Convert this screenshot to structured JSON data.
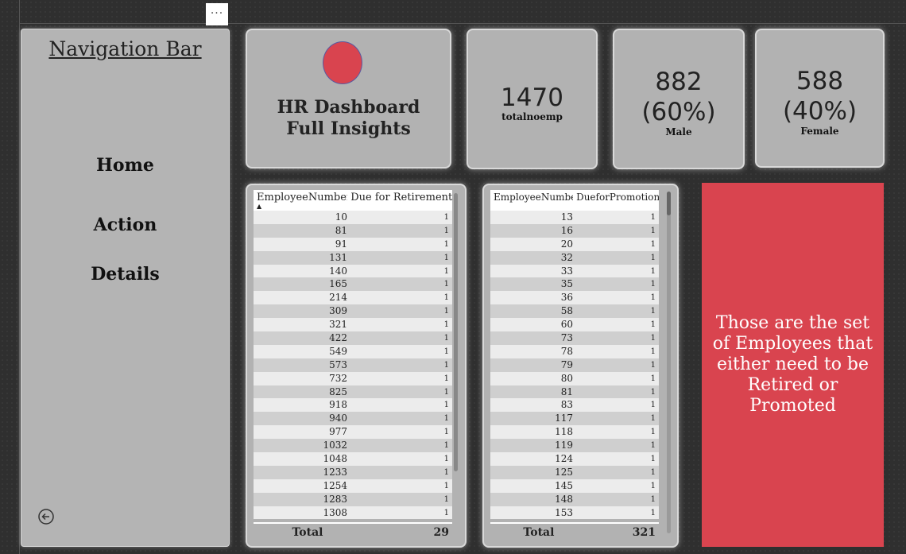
{
  "toolbar": {
    "more_label": "···"
  },
  "nav": {
    "title": "Navigation Bar",
    "items": [
      {
        "label": "Home"
      },
      {
        "label": "Action"
      },
      {
        "label": "Details"
      }
    ]
  },
  "header": {
    "title_line1": "HR Dashboard",
    "title_line2": "Full Insights"
  },
  "kpis": [
    {
      "value": "1470",
      "label": "totalnoemp"
    },
    {
      "value_line1": "882",
      "value_line2": "(60%)",
      "label": "Male"
    },
    {
      "value_line1": "588",
      "value_line2": "(40%)",
      "label": "Female"
    }
  ],
  "retirement_table": {
    "columns": [
      "EmployeeNumber",
      "Due for Retirement"
    ],
    "rows": [
      [
        "10",
        "1"
      ],
      [
        "81",
        "1"
      ],
      [
        "91",
        "1"
      ],
      [
        "131",
        "1"
      ],
      [
        "140",
        "1"
      ],
      [
        "165",
        "1"
      ],
      [
        "214",
        "1"
      ],
      [
        "309",
        "1"
      ],
      [
        "321",
        "1"
      ],
      [
        "422",
        "1"
      ],
      [
        "549",
        "1"
      ],
      [
        "573",
        "1"
      ],
      [
        "732",
        "1"
      ],
      [
        "825",
        "1"
      ],
      [
        "918",
        "1"
      ],
      [
        "940",
        "1"
      ],
      [
        "977",
        "1"
      ],
      [
        "1032",
        "1"
      ],
      [
        "1048",
        "1"
      ],
      [
        "1233",
        "1"
      ],
      [
        "1254",
        "1"
      ],
      [
        "1283",
        "1"
      ],
      [
        "1308",
        "1"
      ]
    ],
    "total_label": "Total",
    "total_value": "29"
  },
  "promotion_table": {
    "columns": [
      "EmployeeNumber",
      "DueforPromotion"
    ],
    "rows": [
      [
        "13",
        "1"
      ],
      [
        "16",
        "1"
      ],
      [
        "20",
        "1"
      ],
      [
        "32",
        "1"
      ],
      [
        "33",
        "1"
      ],
      [
        "35",
        "1"
      ],
      [
        "36",
        "1"
      ],
      [
        "58",
        "1"
      ],
      [
        "60",
        "1"
      ],
      [
        "73",
        "1"
      ],
      [
        "78",
        "1"
      ],
      [
        "79",
        "1"
      ],
      [
        "80",
        "1"
      ],
      [
        "81",
        "1"
      ],
      [
        "83",
        "1"
      ],
      [
        "117",
        "1"
      ],
      [
        "118",
        "1"
      ],
      [
        "119",
        "1"
      ],
      [
        "124",
        "1"
      ],
      [
        "125",
        "1"
      ],
      [
        "145",
        "1"
      ],
      [
        "148",
        "1"
      ],
      [
        "153",
        "1"
      ]
    ],
    "total_label": "Total",
    "total_value": "321"
  },
  "info_panel": {
    "text": "Those are the set of Employees that either need to be Retired or Promoted"
  },
  "colors": {
    "accent_red": "#d9444f",
    "card_gray": "#b2b2b2",
    "background": "#2f2f2f"
  }
}
